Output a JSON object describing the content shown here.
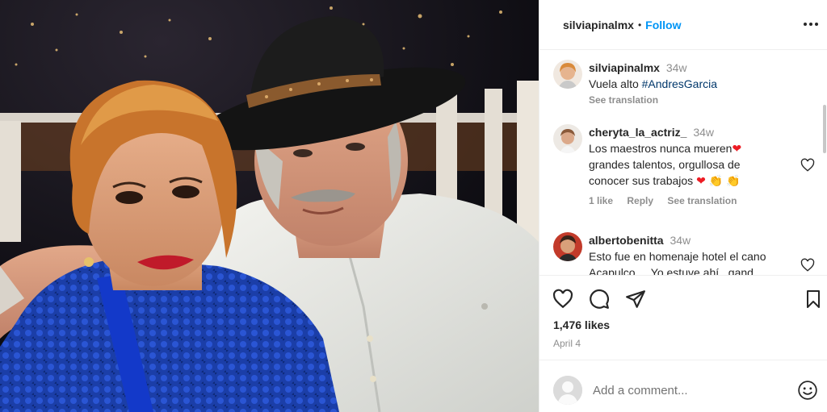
{
  "post": {
    "author": "silviapinalmx",
    "follow_label": "Follow",
    "separator": "•"
  },
  "comments": [
    {
      "user": "silviapinalmx",
      "time": "34w",
      "text_plain": "Vuela alto ",
      "hashtag": "#AndresGarcia",
      "see_translation": "See translation"
    },
    {
      "user": "cheryta_la_actriz_",
      "time": "34w",
      "line1": "Los maestros nunca mueren",
      "line2": "grandes talentos, orgullosa de",
      "line3": "conocer sus trabajos",
      "likes": "1 like",
      "reply": "Reply",
      "see_translation": "See translation"
    },
    {
      "user": "albertobenitta",
      "time": "34w",
      "line1": "Esto fue en homenaje hotel el cano",
      "line2": "Acapulco ... Yo estuve ahí , gand"
    }
  ],
  "actions": {
    "likes": "1,476 likes",
    "date": "April 4"
  },
  "add_comment": {
    "placeholder": "Add a comment..."
  },
  "icons": {
    "like": "heart-icon",
    "comment": "comment-icon",
    "share": "share-icon",
    "save": "bookmark-icon",
    "more": "more-icon",
    "emoji": "emoji-icon"
  },
  "colors": {
    "follow": "#0095f6",
    "hashtag": "#00376b",
    "muted": "#8e8e8e",
    "heart_emoji": "#ed1c24"
  }
}
